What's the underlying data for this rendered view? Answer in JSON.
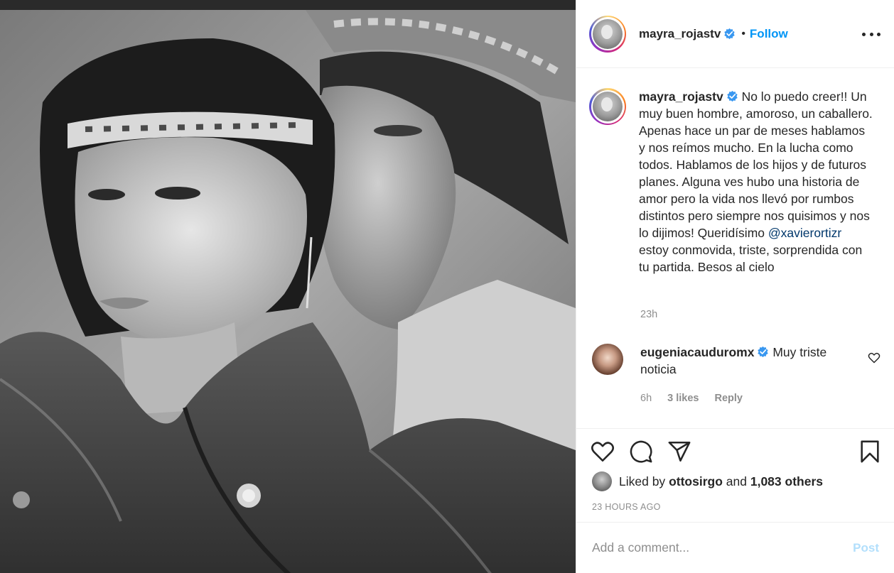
{
  "header": {
    "username": "mayra_rojastv",
    "separator": "•",
    "follow_label": "Follow"
  },
  "caption": {
    "username": "mayra_rojastv",
    "text_before": "No lo puedo creer!! Un muy buen hombre, amoroso, un caballero. Apenas hace un par de meses hablamos y nos reímos mucho. En la lucha como todos. Hablamos de los hijos y de futuros planes. Alguna ves hubo una historia de amor pero la vida nos llevó por rumbos distintos pero siempre nos quisimos y nos lo dijimos! Queridísimo ",
    "mention": "@xavierortizr",
    "text_after": " estoy conmovida, triste, sorprendida con tu partida. Besos al cielo",
    "time": "23h"
  },
  "reply": {
    "username": "eugeniacauduromx",
    "text": "Muy triste noticia",
    "time": "6h",
    "likes": "3 likes",
    "reply_label": "Reply"
  },
  "likes": {
    "prefix": "Liked by",
    "user": "ottosirgo",
    "conjunction": "and",
    "others": "1,083 others"
  },
  "timestamp": "23 HOURS AGO",
  "add_comment": {
    "placeholder": "Add a comment...",
    "post_label": "Post"
  },
  "colors": {
    "follow_blue": "#0095f6",
    "mention_blue": "#00376b",
    "post_disabled": "#b2dffc",
    "muted": "#8e8e8e",
    "verified_blue": "#3897f0"
  },
  "icons": [
    "verified-badge-icon",
    "more-options-icon",
    "heart-icon",
    "comment-icon",
    "share-icon",
    "bookmark-icon"
  ]
}
